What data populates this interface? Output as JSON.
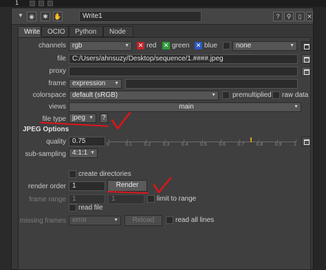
{
  "toolbar": {
    "pane_number": "1"
  },
  "node": {
    "name": "Write1",
    "header_buttons": [
      "?",
      "⚲",
      "▯",
      "✕"
    ]
  },
  "tabs": [
    "Write",
    "OCIO",
    "Python",
    "Node"
  ],
  "active_tab": "Write",
  "rows": {
    "channels": {
      "label": "channels",
      "value": "rgb",
      "red": "red",
      "green": "green",
      "blue": "blue",
      "extra": "none"
    },
    "file": {
      "label": "file",
      "value": "C:/Users/ahnsuzy/Desktop/sequence/1.####.jpeg"
    },
    "proxy": {
      "label": "proxy",
      "value": ""
    },
    "frame": {
      "label": "frame",
      "mode": "expression",
      "value": ""
    },
    "colorspace": {
      "label": "colorspace",
      "value": "default (sRGB)",
      "premultiplied": "premultiplied",
      "raw_data": "raw data"
    },
    "views": {
      "label": "views",
      "value": "main"
    },
    "file_type": {
      "label": "file type",
      "value": "jpeg",
      "help": "?"
    }
  },
  "jpeg_options": {
    "title": "JPEG Options",
    "quality_label": "quality",
    "quality_value": "0.75",
    "slider_ticks": [
      "0",
      "0.1",
      "0.2",
      "0.3",
      "0.4",
      "0.5",
      "0.6",
      "0.7",
      "0.8",
      "0.9",
      "1"
    ],
    "subsampling_label": "sub-sampling",
    "subsampling_value": "4:1:1"
  },
  "render": {
    "create_directories": "create directories",
    "render_order_label": "render order",
    "render_order_value": "1",
    "render_button": "Render",
    "frame_range_label": "frame range",
    "frame_range_start": "1",
    "frame_range_end": "1",
    "limit_to_range": "limit to range",
    "read_file": "read file",
    "missing_frames_label": "missing frames",
    "missing_frames_value": "error",
    "reload_button": "Reload",
    "read_all_lines": "read all lines"
  },
  "colors": {
    "annotation_red": "#e0141a",
    "red_channel": "#c0262b",
    "green_channel": "#2d9c38",
    "blue_channel": "#2b58c4"
  }
}
